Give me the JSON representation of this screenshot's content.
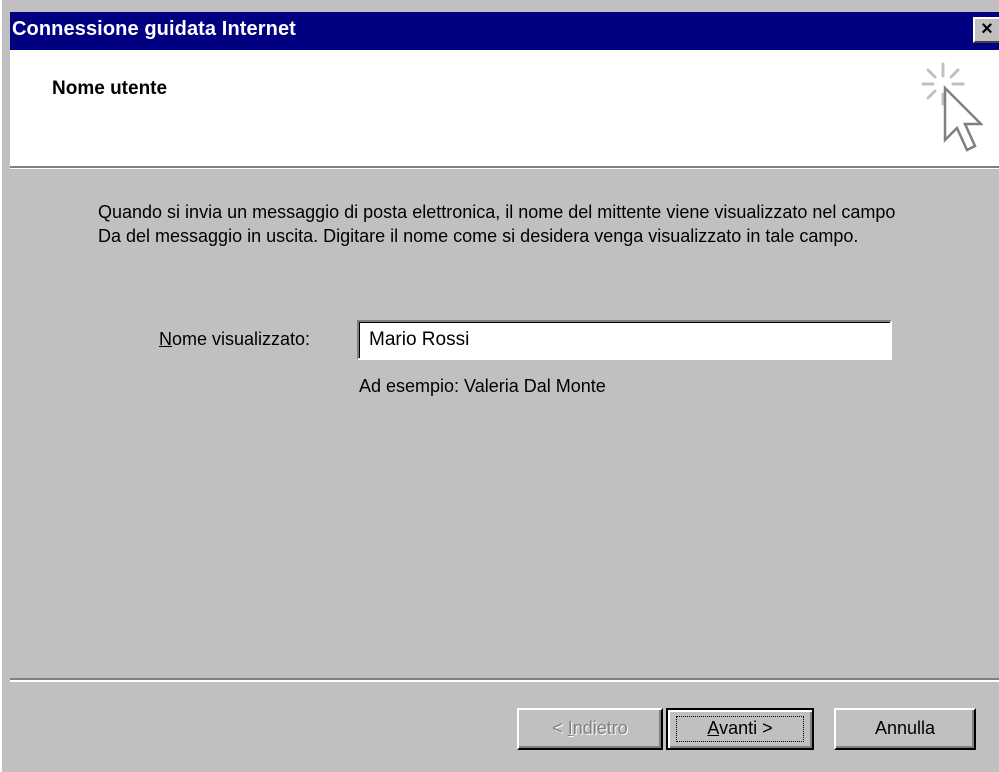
{
  "window": {
    "title": "Connessione guidata Internet",
    "close_symbol": "×"
  },
  "header": {
    "heading": "Nome utente",
    "icon": "wizard-cursor-icon"
  },
  "body": {
    "description": "Quando si invia un messaggio di posta elettronica, il nome del mittente viene visualizzato nel campo Da del messaggio in uscita. Digitare il nome come si desidera venga visualizzato in tale campo.",
    "field_label_accel": "N",
    "field_label_rest": "ome visualizzato:",
    "field_value": "Mario Rossi",
    "example": "Ad esempio: Valeria Dal Monte"
  },
  "buttons": {
    "back_prefix": "< ",
    "back_accel": "I",
    "back_rest": "ndietro",
    "next_accel": "A",
    "next_rest": "vanti >",
    "cancel": "Annulla"
  },
  "colors": {
    "titlebar": "#000080",
    "face": "#c0c0c0",
    "header_bg": "#ffffff"
  }
}
